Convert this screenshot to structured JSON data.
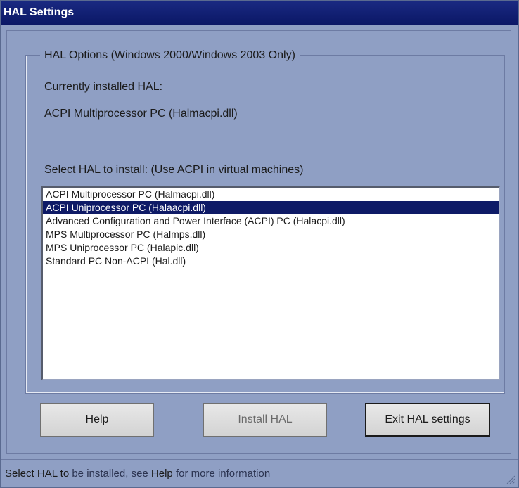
{
  "window": {
    "title": "HAL Settings"
  },
  "group": {
    "legend": "HAL Options (Windows 2000/Windows 2003 Only)",
    "current_label": "Currently installed HAL:",
    "current_value": "ACPI Multiprocessor PC (Halmacpi.dll)",
    "select_label": "Select HAL to install: (Use ACPI in virtual machines)"
  },
  "hal_list": {
    "items": [
      "ACPI Multiprocessor PC (Halmacpi.dll)",
      "ACPI Uniprocessor PC (Halaacpi.dll)",
      "Advanced Configuration and Power Interface (ACPI) PC (Halacpi.dll)",
      "MPS Multiprocessor PC (Halmps.dll)",
      "MPS Uniprocessor PC (Halapic.dll)",
      "Standard PC Non-ACPI (Hal.dll)"
    ],
    "selected": "ACPI Uniprocessor PC (Halaacpi.dll)"
  },
  "buttons": {
    "help": "Help",
    "install": "Install HAL",
    "exit": "Exit HAL settings"
  },
  "status": {
    "text_a": "Select HAL to",
    "text_b": "be installed, see",
    "text_c": "Help",
    "text_d": "for more information"
  }
}
